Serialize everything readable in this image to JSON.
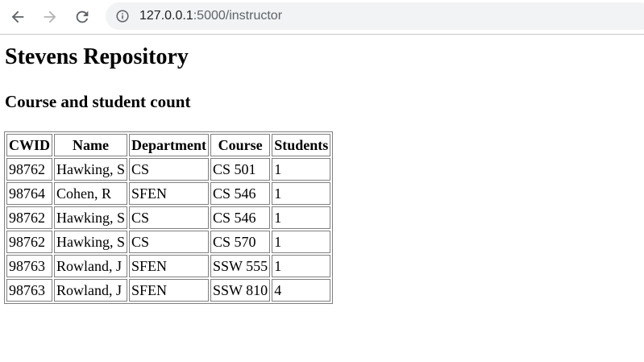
{
  "browser": {
    "url_host": "127.0.0.1",
    "url_rest": ":5000/instructor"
  },
  "page": {
    "title": "Stevens Repository",
    "subtitle": "Course and student count"
  },
  "table": {
    "headers": [
      "CWID",
      "Name",
      "Department",
      "Course",
      "Students"
    ],
    "rows": [
      [
        "98762",
        "Hawking, S",
        "CS",
        "CS 501",
        "1"
      ],
      [
        "98764",
        "Cohen, R",
        "SFEN",
        "CS 546",
        "1"
      ],
      [
        "98762",
        "Hawking, S",
        "CS",
        "CS 546",
        "1"
      ],
      [
        "98762",
        "Hawking, S",
        "CS",
        "CS 570",
        "1"
      ],
      [
        "98763",
        "Rowland, J",
        "SFEN",
        "SSW 555",
        "1"
      ],
      [
        "98763",
        "Rowland, J",
        "SFEN",
        "SSW 810",
        "4"
      ]
    ]
  },
  "icons": {
    "back": "arrow-left-icon",
    "forward": "arrow-right-icon",
    "reload": "reload-icon",
    "site_info": "info-icon"
  },
  "colors": {
    "omnibox_bg": "#f1f3f4",
    "icon": "#5f6368",
    "icon_disabled": "#b4b4b4"
  }
}
